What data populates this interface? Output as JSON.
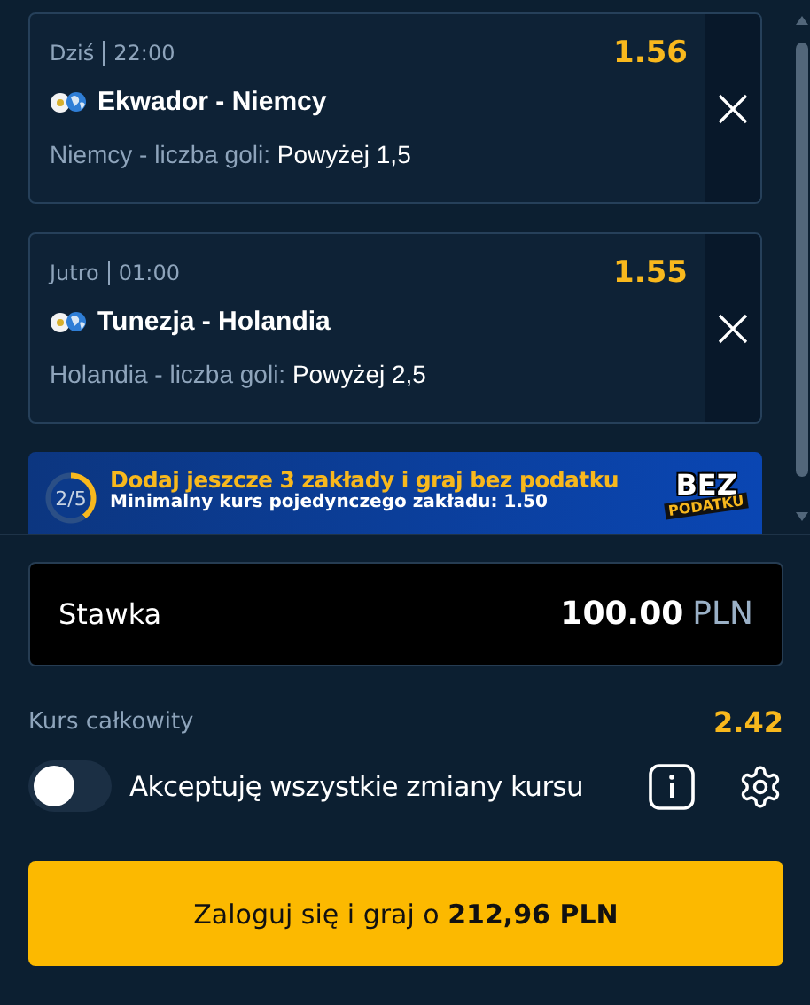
{
  "bets": [
    {
      "day": "Dziś",
      "time": "22:00",
      "odds": "1.56",
      "match": "Ekwador - Niemcy",
      "market": "Niemcy - liczba goli:",
      "selection": "Powyżej 1,5"
    },
    {
      "day": "Jutro",
      "time": "01:00",
      "odds": "1.55",
      "match": "Tunezja - Holandia",
      "market": "Holandia - liczba goli:",
      "selection": "Powyżej 2,5"
    }
  ],
  "promo": {
    "progress": "2/5",
    "text": "Dodaj jeszcze 3 zakłady i graj **bez podatku**",
    "subtext": "Minimalny kurs pojedynczego zakładu: 1.50",
    "logo_top": "BEZ",
    "logo_bottom": "PODATKU"
  },
  "stake": {
    "label": "Stawka",
    "value": "100.00",
    "currency": "PLN"
  },
  "total_odds": {
    "label": "Kurs całkowity",
    "value": "2.42"
  },
  "accept_changes": {
    "label": "Akceptuję wszystkie zmiany kursu",
    "on": false
  },
  "submit": "Zaloguj się i graj o **212,96 PLN**"
}
